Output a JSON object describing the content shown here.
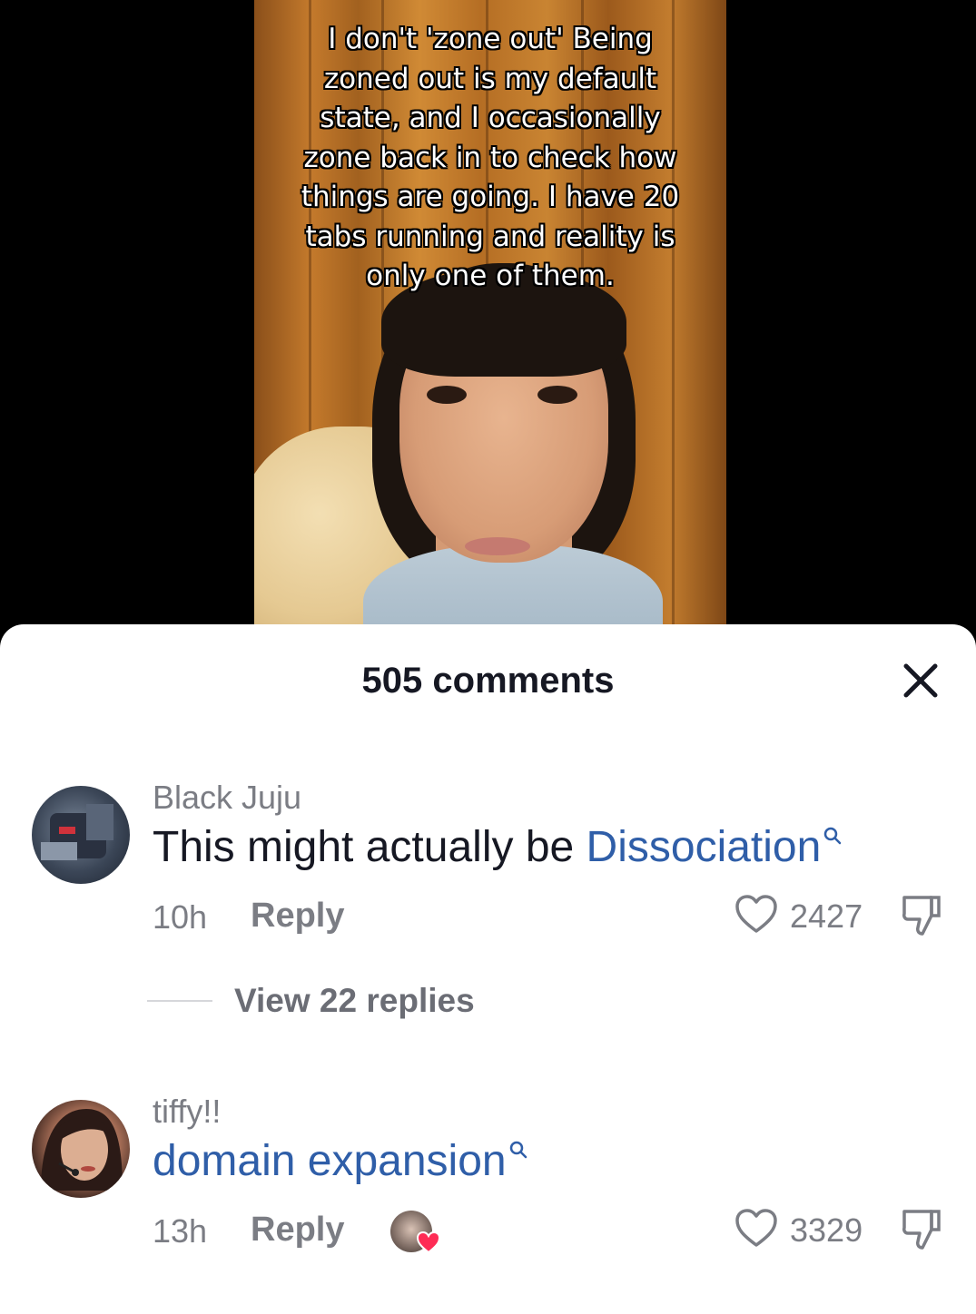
{
  "video": {
    "caption": "I don't 'zone out' Being zoned out is my default state, and I occasionally zone back in to check how things are going. I have 20 tabs running and reality is only one of them."
  },
  "sheet": {
    "title": "505 comments",
    "close_icon": "close-icon"
  },
  "comments": [
    {
      "username": "Black Juju",
      "text": "This might actually be ",
      "link_text": "Dissociation",
      "time": "10h",
      "reply_label": "Reply",
      "likes": "2427",
      "view_replies": "View 22 replies"
    },
    {
      "username": "tiffy!!",
      "link_text": "domain expansion",
      "time": "13h",
      "reply_label": "Reply",
      "likes": "3329"
    }
  ],
  "colors": {
    "link": "#2f5ea8",
    "text": "#161823",
    "muted": "#7b7d84",
    "heart_badge": "#fe2c55"
  }
}
